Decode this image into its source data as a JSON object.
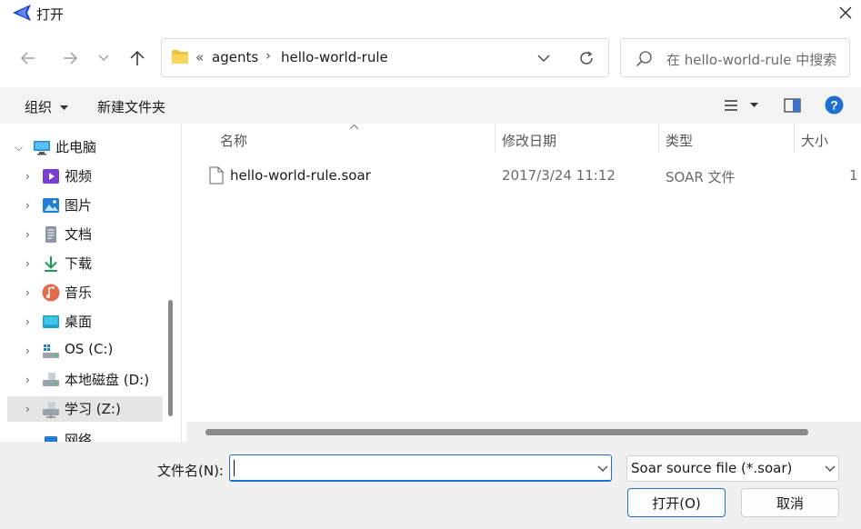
{
  "window": {
    "title": "打开"
  },
  "breadcrumb": {
    "overflow": "«",
    "parts": [
      "agents",
      "hello-world-rule"
    ]
  },
  "search": {
    "placeholder": "在 hello-world-rule 中搜索"
  },
  "toolbar": {
    "organize_label": "组织",
    "new_folder_label": "新建文件夹"
  },
  "nav": {
    "items": [
      {
        "label": "此电脑",
        "icon": "monitor-icon"
      },
      {
        "label": "视频",
        "icon": "video-icon"
      },
      {
        "label": "图片",
        "icon": "pictures-icon"
      },
      {
        "label": "文档",
        "icon": "document-icon"
      },
      {
        "label": "下载",
        "icon": "download-icon"
      },
      {
        "label": "音乐",
        "icon": "music-icon"
      },
      {
        "label": "桌面",
        "icon": "desktop-icon"
      },
      {
        "label": "OS (C:)",
        "icon": "drive-icon"
      },
      {
        "label": "本地磁盘 (D:)",
        "icon": "drive-icon"
      },
      {
        "label": "学习 (Z:)",
        "icon": "network-drive-icon"
      }
    ],
    "partial_label": "网络"
  },
  "columns": {
    "name": "名称",
    "modified": "修改日期",
    "type": "类型",
    "size": "大小"
  },
  "files": [
    {
      "name": "hello-world-rule.soar",
      "modified": "2017/3/24 11:12",
      "type": "SOAR 文件",
      "size": "1"
    }
  ],
  "footer": {
    "filename_label": "文件名(N):",
    "filename_value": "",
    "filetype_value": "Soar source file (*.soar)",
    "open_label": "打开(O)",
    "cancel_label": "取消"
  },
  "colors": {
    "accent": "#1f6fd0",
    "selected_nav": "#e5e5e5",
    "help": "#1f6fd0"
  }
}
